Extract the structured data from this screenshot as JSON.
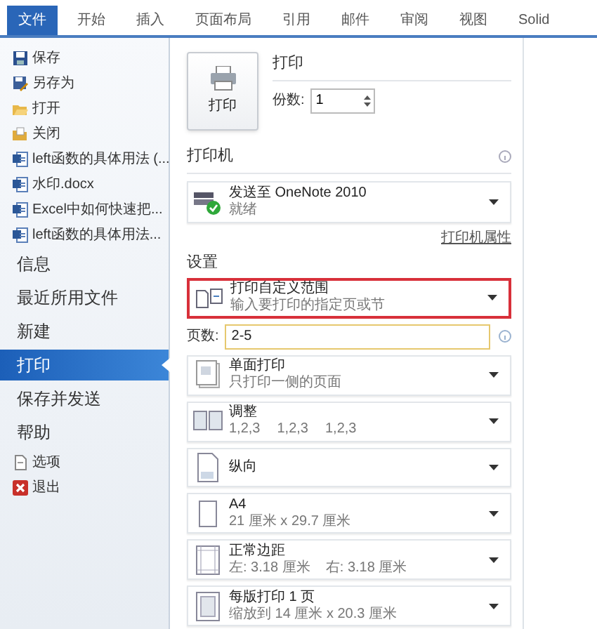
{
  "tabs": [
    {
      "label": "文件",
      "selected": true
    },
    {
      "label": "开始",
      "selected": false
    },
    {
      "label": "插入",
      "selected": false
    },
    {
      "label": "页面布局",
      "selected": false
    },
    {
      "label": "引用",
      "selected": false
    },
    {
      "label": "邮件",
      "selected": false
    },
    {
      "label": "审阅",
      "selected": false
    },
    {
      "label": "视图",
      "selected": false
    },
    {
      "label": "Solid",
      "selected": false
    }
  ],
  "sidebar": {
    "items": [
      {
        "kind": "save",
        "label": "保存",
        "selected": false
      },
      {
        "kind": "saveas",
        "label": "另存为",
        "selected": false
      },
      {
        "kind": "open",
        "label": "打开",
        "selected": false
      },
      {
        "kind": "close",
        "label": "关闭",
        "selected": false
      },
      {
        "kind": "file",
        "label": "left函数的具体用法 (...",
        "selected": false
      },
      {
        "kind": "file",
        "label": "水印.docx",
        "selected": false
      },
      {
        "kind": "file",
        "label": "Excel中如何快速把...",
        "selected": false
      },
      {
        "kind": "file",
        "label": "left函数的具体用法...",
        "selected": false
      },
      {
        "kind": "section",
        "label": "信息",
        "selected": false
      },
      {
        "kind": "section",
        "label": "最近所用文件",
        "selected": false
      },
      {
        "kind": "section",
        "label": "新建",
        "selected": false
      },
      {
        "kind": "section",
        "label": "打印",
        "selected": true
      },
      {
        "kind": "section",
        "label": "保存并发送",
        "selected": false
      },
      {
        "kind": "section",
        "label": "帮助",
        "selected": false
      },
      {
        "kind": "options",
        "label": "选项",
        "selected": false
      },
      {
        "kind": "exit",
        "label": "退出",
        "selected": false
      }
    ]
  },
  "print": {
    "button": "打印",
    "heading": "打印",
    "copies_label": "份数:",
    "copies": "1"
  },
  "printer": {
    "heading": "打印机",
    "name": "发送至 OneNote 2010",
    "status": "就绪",
    "properties_link": "打印机属性"
  },
  "settings": {
    "heading": "设置",
    "items": [
      {
        "kind": "range",
        "title": "打印自定义范围",
        "subtitle": "输入要打印的指定页或节",
        "highlighted": true
      },
      {
        "kind": "pages",
        "label": "页数:",
        "value": "2-5"
      },
      {
        "kind": "sides",
        "title": "单面打印",
        "subtitle": "只打印一侧的页面",
        "highlighted": false
      },
      {
        "kind": "collate",
        "title": "调整",
        "groups": [
          "1,2,3",
          "1,2,3",
          "1,2,3"
        ],
        "highlighted": false
      },
      {
        "kind": "orientation",
        "title": "纵向",
        "highlighted": false
      },
      {
        "kind": "paper",
        "title": "A4",
        "subtitle": "21 厘米 x 29.7 厘米",
        "highlighted": false
      },
      {
        "kind": "margins",
        "title": "正常边距",
        "subtitle": "左: 3.18 厘米    右: 3.18 厘米",
        "highlighted": false
      },
      {
        "kind": "persheet",
        "title": "每版打印 1 页",
        "subtitle": "缩放到 14 厘米 x 20.3 厘米",
        "highlighted": false
      }
    ]
  }
}
